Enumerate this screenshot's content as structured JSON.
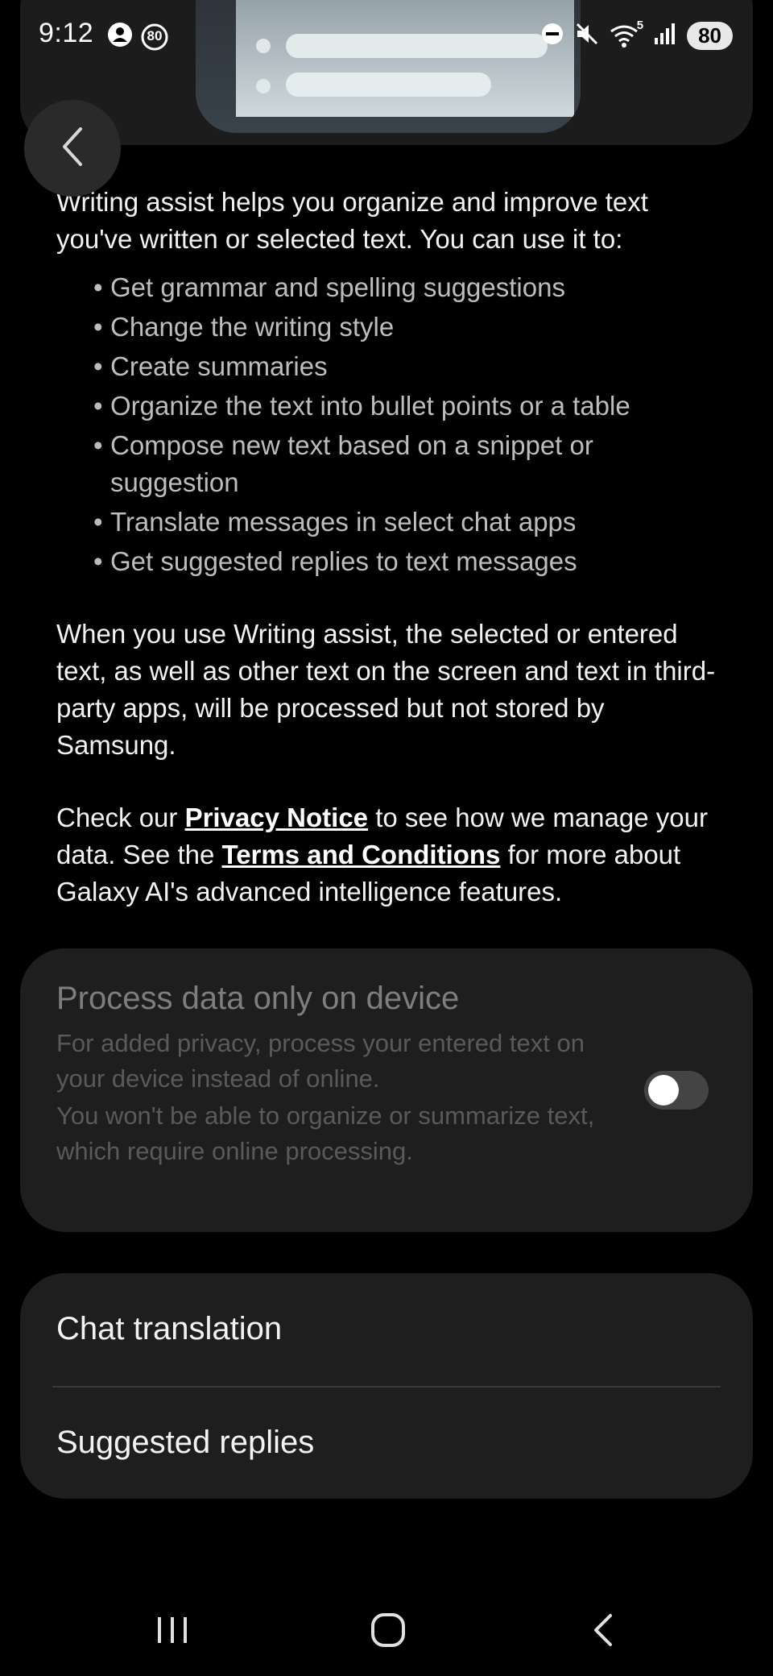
{
  "status_bar": {
    "time": "9:12",
    "notification_badge": "80",
    "network_label": "5",
    "battery": "80",
    "icons": [
      "account-circle-icon",
      "notification-count-icon",
      "do-not-disturb-icon",
      "mute-icon",
      "wifi-icon",
      "signal-icon"
    ]
  },
  "header": {
    "back_icon": "chevron-left-icon"
  },
  "intro": {
    "text": "Writing assist helps you organize and improve text you've written or selected text. You can use it to:"
  },
  "features": [
    "Get grammar and spelling suggestions",
    "Change the writing style",
    "Create summaries",
    "Organize the text into bullet points or a table",
    "Compose new text based on a snippet or suggestion",
    "Translate messages in select chat apps",
    "Get suggested replies to text messages"
  ],
  "processing_note": "When you use Writing assist, the selected or entered text, as well as other text on the screen and text in third-party apps, will be processed but not stored by Samsung.",
  "privacy": {
    "prefix": "Check our ",
    "privacy_link": "Privacy Notice",
    "middle": " to see how we manage your data. See the ",
    "terms_link": "Terms and Conditions",
    "suffix": " for more about Galaxy AI's advanced intelligence features."
  },
  "on_device_setting": {
    "title": "Process data only on device",
    "description": "For added privacy, process your entered text on your device instead of online.",
    "warning": "You won't be able to organize or summarize text, which require online processing.",
    "toggle_state": "off",
    "enabled": false
  },
  "options": [
    {
      "label": "Chat translation"
    },
    {
      "label": "Suggested replies"
    }
  ],
  "navigation_bar": {
    "recents_icon": "recent-apps-icon",
    "home_icon": "home-icon",
    "back_icon": "back-nav-icon"
  },
  "colors": {
    "background": "#000000",
    "card": "#1e1e1e",
    "text_primary": "#f2f2f2",
    "text_secondary": "#bdbdbd",
    "text_disabled": "#5a5a5a"
  }
}
